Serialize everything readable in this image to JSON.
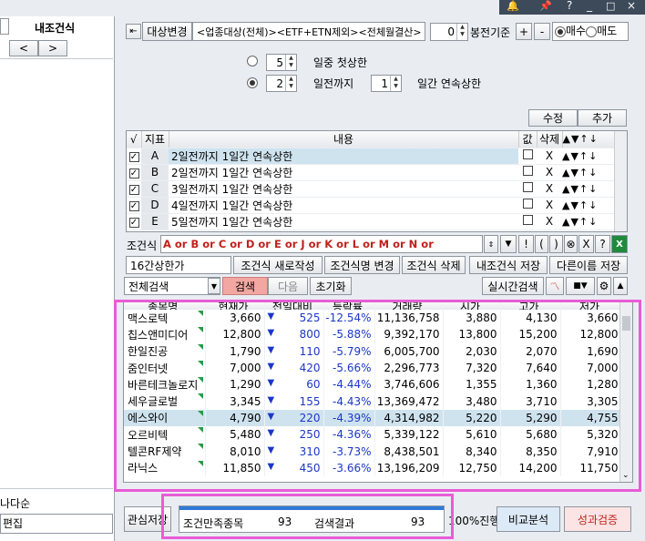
{
  "left_panel": {
    "title": "내조건식",
    "nav_prev": "<",
    "nav_next": ">",
    "bottom_item1": "나다순",
    "bottom_item2": "편집"
  },
  "top_bar": {
    "target_change_label": "대상변경",
    "target_desc": "<업종대상(전체)><ETF+ETN제외><전체월결산>",
    "bong_value": "0",
    "bong_label": "봉전기준",
    "plus": "+",
    "minus": "-",
    "radio_buy": "매수",
    "radio_sell": "매도"
  },
  "condition_editor": {
    "row1_value": "5",
    "row1_text": "일중 첫상한",
    "row2_value": "2",
    "row2_text": "일전까지",
    "row2_value2": "1",
    "row2_text2": "일간 연속상한",
    "edit_button": "수정",
    "add_button": "추가"
  },
  "condition_table": {
    "headers": {
      "check": "√",
      "index": "지표",
      "content": "내용",
      "value": "값",
      "delete": "삭제"
    },
    "rows": [
      {
        "index": "A",
        "content": "2일전까지 1일간 연속상한",
        "delete": "X"
      },
      {
        "index": "B",
        "content": "2일전까지 1일간 연속상한",
        "delete": "X"
      },
      {
        "index": "C",
        "content": "3일전까지 1일간 연속상한",
        "delete": "X"
      },
      {
        "index": "D",
        "content": "4일전까지 1일간 연속상한",
        "delete": "X"
      },
      {
        "index": "E",
        "content": "5일전까지 1일간 연속상한",
        "delete": "X"
      }
    ]
  },
  "formula": {
    "label": "조건식",
    "expression": "A or B or C or D or E or J or K or L or M or N or",
    "ops": [
      "!",
      "(",
      ")",
      "⊗",
      "X",
      "?"
    ]
  },
  "condition_actions": {
    "name_value": "16간상한가",
    "new_button": "조건식 새로작성",
    "rename_button": "조건식명 변경",
    "delete_button": "조건식 삭제",
    "save_button": "내조건식 저장",
    "saveas_button": "다른이름 저장"
  },
  "search_bar": {
    "scope": "전체검색",
    "search_button": "검색",
    "next_button": "다음",
    "reset_button": "초기화",
    "realtime_button": "실시간검색"
  },
  "result_table": {
    "headers": [
      "종목명",
      "현재가",
      "전일대비",
      "등락률",
      "거래량",
      "시가",
      "고가",
      "저가"
    ],
    "rows": [
      {
        "name": "맥스로텍",
        "price": "3,660",
        "change": "525",
        "rate": "-12.54%",
        "volume": "11,136,758",
        "open": "3,880",
        "high": "4,130",
        "low": "3,660"
      },
      {
        "name": "칩스앤미디어",
        "price": "12,800",
        "change": "800",
        "rate": "-5.88%",
        "volume": "9,392,170",
        "open": "13,800",
        "high": "15,200",
        "low": "12,800"
      },
      {
        "name": "한일진공",
        "price": "1,790",
        "change": "110",
        "rate": "-5.79%",
        "volume": "6,005,700",
        "open": "2,030",
        "high": "2,070",
        "low": "1,690"
      },
      {
        "name": "줌인터넷",
        "price": "7,000",
        "change": "420",
        "rate": "-5.66%",
        "volume": "2,296,773",
        "open": "7,320",
        "high": "7,640",
        "low": "7,000"
      },
      {
        "name": "바른테크놀로지",
        "price": "1,290",
        "change": "60",
        "rate": "-4.44%",
        "volume": "3,746,606",
        "open": "1,355",
        "high": "1,360",
        "low": "1,280"
      },
      {
        "name": "세우글로벌",
        "price": "3,345",
        "change": "155",
        "rate": "-4.43%",
        "volume": "13,369,472",
        "open": "3,480",
        "high": "3,710",
        "low": "3,305"
      },
      {
        "name": "에스와이",
        "price": "4,790",
        "change": "220",
        "rate": "-4.39%",
        "volume": "4,314,982",
        "open": "5,220",
        "high": "5,290",
        "low": "4,755"
      },
      {
        "name": "오르비텍",
        "price": "5,480",
        "change": "250",
        "rate": "-4.36%",
        "volume": "5,339,122",
        "open": "5,610",
        "high": "5,680",
        "low": "5,320"
      },
      {
        "name": "텔콘RF제약",
        "price": "8,010",
        "change": "310",
        "rate": "-3.73%",
        "volume": "8,438,501",
        "open": "8,340",
        "high": "8,350",
        "low": "7,910"
      },
      {
        "name": "라닉스",
        "price": "11,850",
        "change": "450",
        "rate": "-3.66%",
        "volume": "13,196,209",
        "open": "12,750",
        "high": "14,200",
        "low": "11,750"
      }
    ]
  },
  "footer": {
    "watch_button": "관심저장",
    "matched_label": "조건만족종목",
    "matched_count": "93",
    "result_label": "검색결과",
    "result_count": "93",
    "progress_text": "100%진행",
    "progress_value": 1.0,
    "compare_button": "비교분석",
    "verify_button": "성과검증"
  },
  "colors": {
    "negative": "#1a37c8",
    "highlight_row": "#cfe3ef",
    "annotation": "#e85cd6",
    "search_button_bg": "#f2a7a2"
  }
}
